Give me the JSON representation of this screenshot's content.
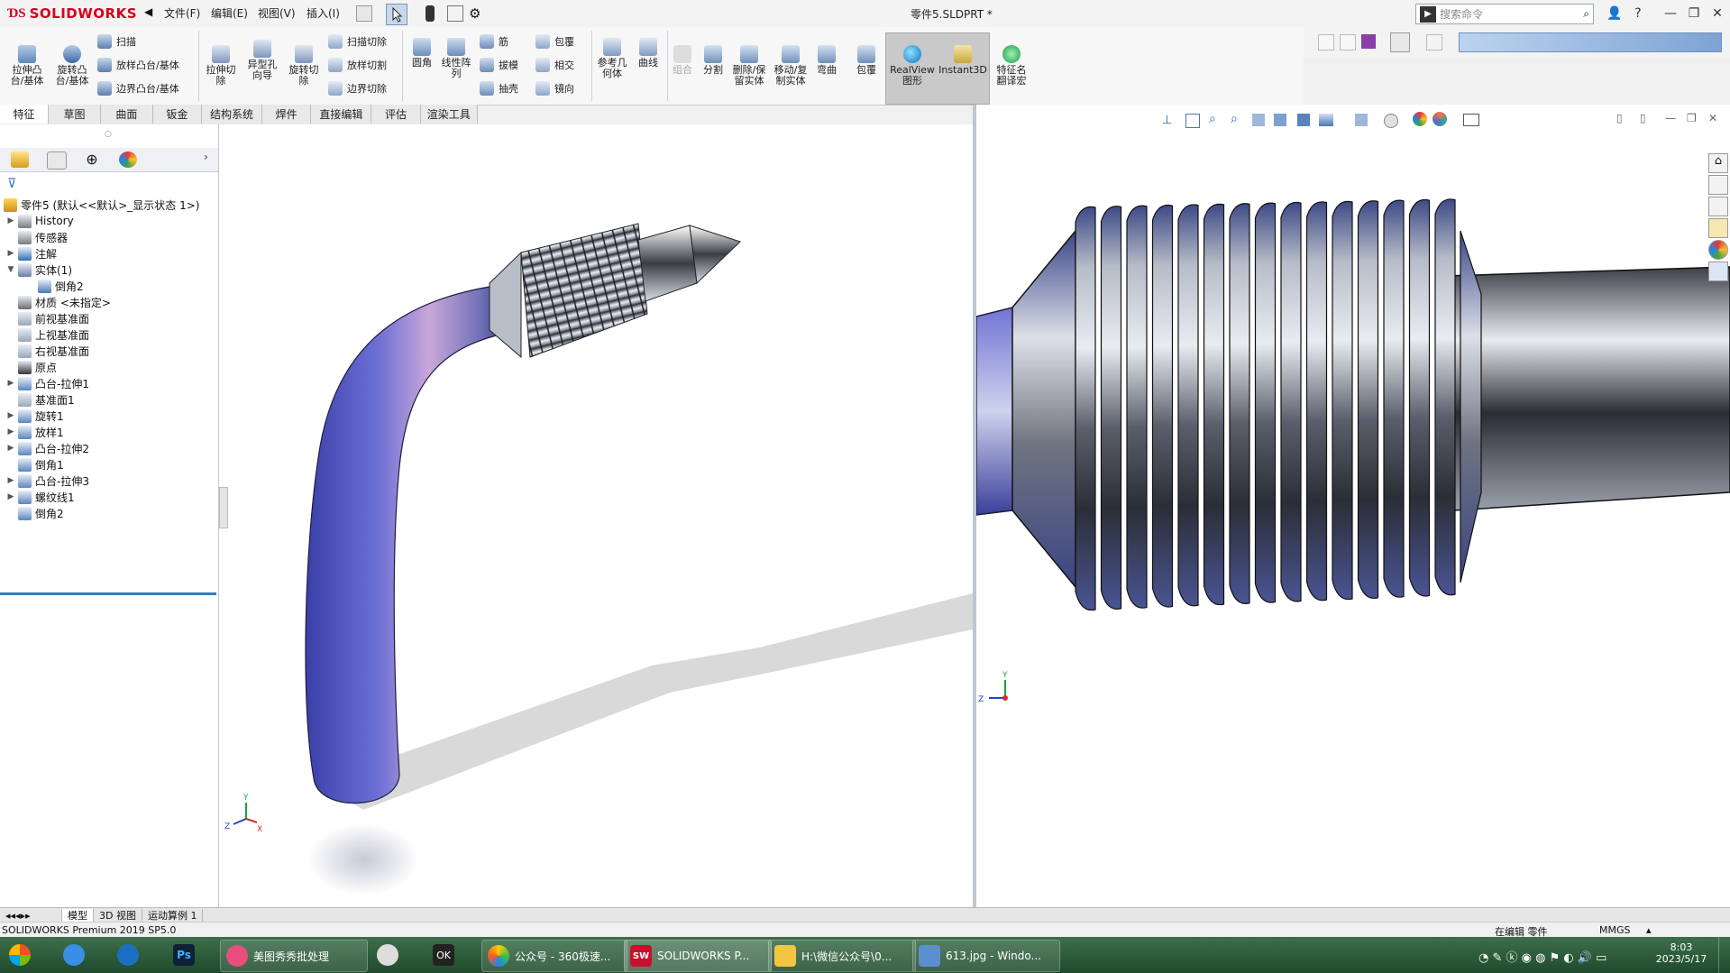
{
  "app": {
    "brand": "SOLIDWORKS",
    "doc_title": "零件5.SLDPRT *",
    "menus": [
      "文件(F)",
      "编辑(E)",
      "视图(V)",
      "插入(I)"
    ],
    "search_placeholder": "搜索命令",
    "help_label": "?"
  },
  "command_manager": {
    "big_buttons": [
      {
        "label": "拉伸凸\n台/基体"
      },
      {
        "label": "旋转凸\n台/基体"
      }
    ],
    "boss_rows": [
      "扫描",
      "放样凸台/基体",
      "边界凸台/基体"
    ],
    "cut_big": [
      {
        "label": "拉伸切\n除"
      },
      {
        "label": "异型孔\n向导"
      },
      {
        "label": "旋转切\n除"
      }
    ],
    "cut_rows": [
      "扫描切除",
      "放样切割",
      "边界切除"
    ],
    "fillet": {
      "label": "圆角"
    },
    "pattern": {
      "label": "线性阵\n列"
    },
    "rows3": [
      "筋",
      "拔模",
      "抽壳"
    ],
    "rows4": [
      "包覆",
      "相交",
      "镜向"
    ],
    "ref_geometry": {
      "label": "参考几\n何体"
    },
    "curves": {
      "label": "曲线"
    },
    "combine": {
      "label": "组合"
    },
    "split": {
      "label": "分割"
    },
    "delete_keep": {
      "label": "删除/保\n留实体"
    },
    "move_copy": {
      "label": "移动/复\n制实体"
    },
    "flex": {
      "label": "弯曲"
    },
    "wrap": {
      "label": "包覆"
    },
    "realview": {
      "label": "RealView\n图形"
    },
    "instant3d": {
      "label": "Instant3D"
    },
    "feature_name": {
      "label": "特征名\n翻译宏"
    }
  },
  "tabs": [
    "特征",
    "草图",
    "曲面",
    "钣金",
    "结构系统",
    "焊件",
    "直接编辑",
    "评估",
    "渲染工具"
  ],
  "active_tab": "特征",
  "feature_tree": {
    "root": "零件5 (默认<<默认>_显示状态 1>)",
    "items": [
      {
        "label": "History",
        "icon": "history-icon",
        "expandable": true,
        "indent": 1,
        "color": "#7a7a7a"
      },
      {
        "label": "传感器",
        "icon": "sensor-icon",
        "expandable": false,
        "indent": 1,
        "color": "#7a7a7a"
      },
      {
        "label": "注解",
        "icon": "annotation-icon",
        "expandable": true,
        "indent": 1,
        "color": "#2f6fb3"
      },
      {
        "label": "实体(1)",
        "icon": "solid-bodies-icon",
        "expandable": true,
        "expanded": true,
        "indent": 1,
        "color": "#6a7fa5"
      },
      {
        "label": "倒角2",
        "icon": "body-icon",
        "expandable": false,
        "indent": 2,
        "color": "#4a78b5"
      },
      {
        "label": "材质 <未指定>",
        "icon": "material-icon",
        "expandable": false,
        "indent": 1,
        "color": "#6b6b6b"
      },
      {
        "label": "前视基准面",
        "icon": "plane-icon",
        "expandable": false,
        "indent": 1,
        "color": "#9aa7b8"
      },
      {
        "label": "上视基准面",
        "icon": "plane-icon",
        "expandable": false,
        "indent": 1,
        "color": "#9aa7b8"
      },
      {
        "label": "右视基准面",
        "icon": "plane-icon",
        "expandable": false,
        "indent": 1,
        "color": "#9aa7b8"
      },
      {
        "label": "原点",
        "icon": "origin-icon",
        "expandable": false,
        "indent": 1,
        "color": "#333333"
      },
      {
        "label": "凸台-拉伸1",
        "icon": "extrude-icon",
        "expandable": true,
        "indent": 1,
        "color": "#5a86c0"
      },
      {
        "label": "基准面1",
        "icon": "plane-icon",
        "expandable": false,
        "indent": 1,
        "color": "#9aa7b8"
      },
      {
        "label": "旋转1",
        "icon": "revolve-icon",
        "expandable": true,
        "indent": 1,
        "color": "#5a86c0"
      },
      {
        "label": "放样1",
        "icon": "loft-icon",
        "expandable": true,
        "indent": 1,
        "color": "#5a86c0"
      },
      {
        "label": "凸台-拉伸2",
        "icon": "extrude-icon",
        "expandable": true,
        "indent": 1,
        "color": "#5a86c0"
      },
      {
        "label": "倒角1",
        "icon": "chamfer-icon",
        "expandable": false,
        "indent": 1,
        "color": "#5a86c0"
      },
      {
        "label": "凸台-拉伸3",
        "icon": "extrude-icon",
        "expandable": true,
        "indent": 1,
        "color": "#5a86c0"
      },
      {
        "label": "螺纹线1",
        "icon": "thread-icon",
        "expandable": true,
        "indent": 1,
        "color": "#5a86c0"
      },
      {
        "label": "倒角2",
        "icon": "chamfer-icon",
        "expandable": false,
        "indent": 1,
        "color": "#5a86c0"
      }
    ]
  },
  "bottom_tabs": [
    "模型",
    "3D 视图",
    "运动算例 1"
  ],
  "status": {
    "left": "SOLIDWORKS Premium 2019 SP5.0",
    "editing": "在编辑 零件",
    "units": "MMGS"
  },
  "taskbar": {
    "tasks": [
      "美图秀秀批处理",
      "公众号 - 360极速...",
      "SOLIDWORKS P...",
      "H:\\微信公众号\\0...",
      "613.jpg - Windo..."
    ],
    "time": "8:03",
    "date": "2023/5/17"
  },
  "colors": {
    "brand_red": "#d6001c",
    "selection_blue": "#2a7fc1",
    "taskbar_green": "#2d5a38"
  }
}
